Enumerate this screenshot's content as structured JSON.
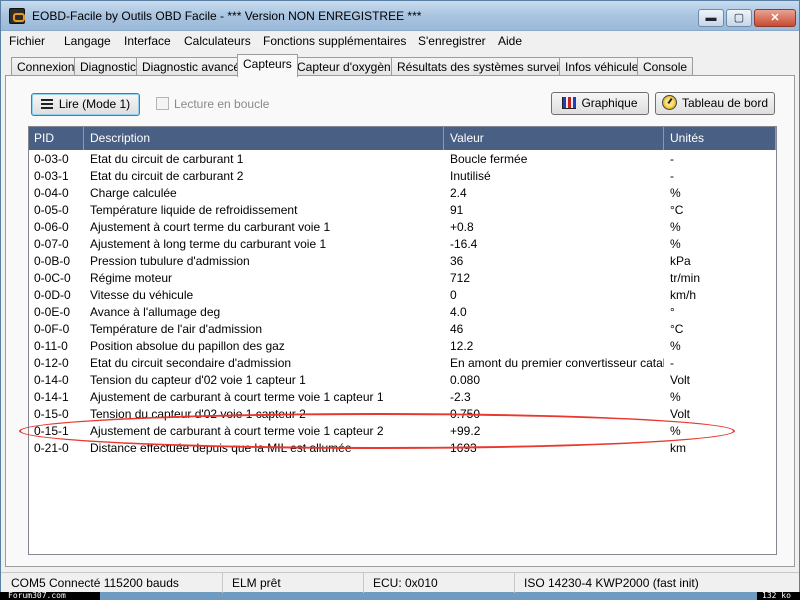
{
  "window": {
    "title": "EOBD-Facile by Outils OBD Facile - *** Version NON ENREGISTREE ***",
    "icon": "obd-app-icon",
    "controls": {
      "minimize": "▬",
      "maximize": "▢",
      "close": "✕"
    }
  },
  "menu": {
    "items": [
      "Fichier",
      "Langage",
      "Interface",
      "Calculateurs",
      "Fonctions supplémentaires",
      "S'enregistrer",
      "Aide"
    ]
  },
  "tabs": {
    "items": [
      "Connexion",
      "Diagnostic",
      "Diagnostic avancé",
      "Capteurs",
      "Capteur d'oxygène",
      "Résultats des systèmes surveillés",
      "Infos véhicule",
      "Console"
    ],
    "active": "Capteurs"
  },
  "toolbar": {
    "read_label": "Lire (Mode 1)",
    "loop_label": "Lecture en boucle",
    "loop_checked": false,
    "graph_label": "Graphique",
    "dashboard_label": "Tableau de bord"
  },
  "table": {
    "columns": [
      "PID",
      "Description",
      "Valeur",
      "Unités"
    ],
    "rows": [
      [
        "0-03-0",
        "Etat du circuit de carburant 1",
        "Boucle fermée",
        "-"
      ],
      [
        "0-03-1",
        "Etat du circuit de carburant 2",
        "Inutilisé",
        "-"
      ],
      [
        "0-04-0",
        "Charge calculée",
        "2.4",
        "%"
      ],
      [
        "0-05-0",
        "Température liquide de refroidissement",
        "91",
        "°C"
      ],
      [
        "0-06-0",
        "Ajustement à court terme du carburant voie 1",
        "+0.8",
        "%"
      ],
      [
        "0-07-0",
        "Ajustement à long terme du carburant voie 1",
        "-16.4",
        "%"
      ],
      [
        "0-0B-0",
        "Pression tubulure d'admission",
        "36",
        "kPa"
      ],
      [
        "0-0C-0",
        "Régime moteur",
        "712",
        "tr/min"
      ],
      [
        "0-0D-0",
        "Vitesse du véhicule",
        "0",
        "km/h"
      ],
      [
        "0-0E-0",
        "Avance à l'allumage deg",
        "4.0",
        "°"
      ],
      [
        "0-0F-0",
        "Température de l'air d'admission",
        "46",
        "°C"
      ],
      [
        "0-11-0",
        "Position absolue du papillon des gaz",
        "12.2",
        "%"
      ],
      [
        "0-12-0",
        "Etat du circuit secondaire d'admission",
        "En amont du premier convertisseur cataly...",
        "-"
      ],
      [
        "0-14-0",
        "Tension du capteur d'02 voie 1 capteur 1",
        "0.080",
        "Volt"
      ],
      [
        "0-14-1",
        "Ajustement de carburant à court terme voie 1 capteur 1",
        "-2.3",
        "%"
      ],
      [
        "0-15-0",
        "Tension du capteur d'02 voie 1 capteur 2",
        "0.750",
        "Volt"
      ],
      [
        "0-15-1",
        "Ajustement de carburant à court terme voie 1 capteur 2",
        "+99.2",
        "%"
      ],
      [
        "0-21-0",
        "Distance effectuée depuis que la MIL est allumée",
        "1693",
        "km"
      ]
    ],
    "highlighted_row": "0-15-1"
  },
  "status": {
    "com": "COM5 Connecté 115200 bauds",
    "elm": "ELM prêt",
    "ecu": "ECU: 0x010",
    "protocol": "ISO 14230-4 KWP2000 (fast init)"
  },
  "watermark": {
    "left": "Forum307.com",
    "right": "132 ko"
  },
  "colors": {
    "header_bg": "#4a5f84",
    "highlight_ellipse": "#e8382f",
    "titlebar": "#a9c4e0"
  }
}
